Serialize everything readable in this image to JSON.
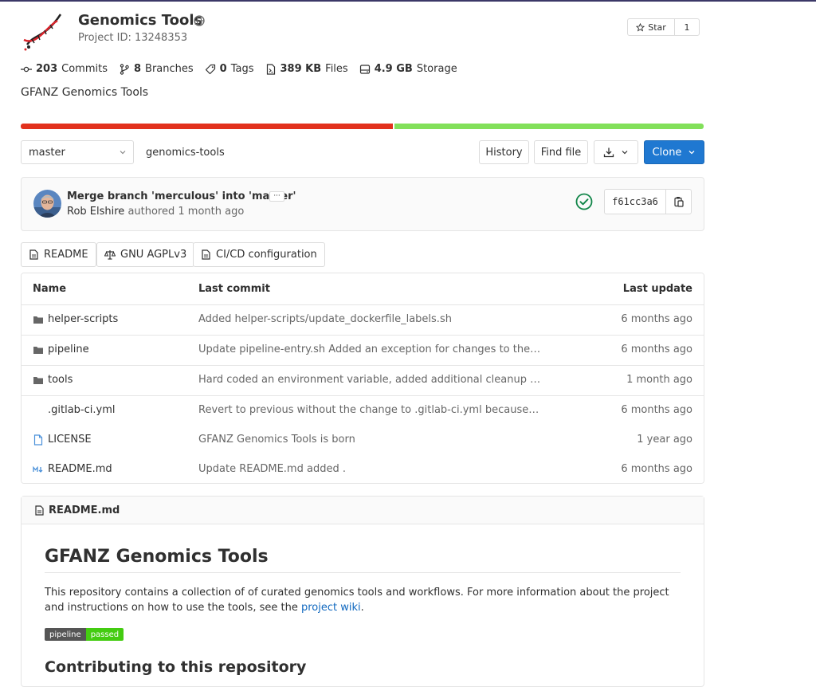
{
  "project": {
    "title": "Genomics Tools",
    "id_text": "Project ID: 13248353",
    "description": "GFANZ Genomics Tools"
  },
  "star": {
    "label": "Star",
    "count": "1"
  },
  "stats": [
    {
      "icon": "commit-icon",
      "value": "203",
      "label": "Commits"
    },
    {
      "icon": "branch-icon",
      "value": "8",
      "label": "Branches"
    },
    {
      "icon": "tag-icon",
      "value": "0",
      "label": "Tags"
    },
    {
      "icon": "file-icon",
      "value": "389 KB",
      "label": "Files"
    },
    {
      "icon": "storage-icon",
      "value": "4.9 GB",
      "label": "Storage"
    }
  ],
  "languages": [
    {
      "color": "#e2311d",
      "share": 0.545
    },
    {
      "color": "#82e05a",
      "share": 0.455
    }
  ],
  "toolbar": {
    "branch": "master",
    "path": "genomics-tools",
    "history": "History",
    "find_file": "Find file",
    "clone": "Clone"
  },
  "commit": {
    "title": "Merge branch 'merculous' into 'master'",
    "more": "···",
    "author": "Rob Elshire",
    "action": "authored",
    "time": "1 month ago",
    "sha": "f61cc3a6",
    "status_color": "#108548"
  },
  "pills": {
    "readme": "README",
    "license": "GNU AGPLv3",
    "ci": "CI/CD configuration"
  },
  "table": {
    "headers": {
      "name": "Name",
      "last_commit": "Last commit",
      "last_update": "Last update"
    },
    "rows": [
      {
        "icon": "folder-icon",
        "name": "helper-scripts",
        "message": "Added helper-scripts/update_dockerfile_labels.sh",
        "date": "6 months ago"
      },
      {
        "icon": "folder-icon",
        "name": "pipeline",
        "message": "Update pipeline-entry.sh Added an exception for changes to the README",
        "date": "6 months ago"
      },
      {
        "icon": "folder-icon",
        "name": "tools",
        "message": "Hard coded an environment variable, added additional cleanup steps",
        "date": "1 month ago"
      },
      {
        "icon": "",
        "name": ".gitlab-ci.yml",
        "message": "Revert to previous without the change to .gitlab-ci.yml because that was",
        "date": "6 months ago"
      },
      {
        "icon": "license-file-icon",
        "name": "LICENSE",
        "message": "GFANZ Genomics Tools is born",
        "date": "1 year ago"
      },
      {
        "icon": "markdown-icon",
        "name": "README.md",
        "message": "Update README.md added .",
        "date": "6 months ago"
      }
    ]
  },
  "readme": {
    "filename": "README.md",
    "h1": "GFANZ Genomics Tools",
    "paragraph_before_link": "This repository contains a collection of of curated genomics tools and workflows. For more information about the project and instructions on how to use the tools, see the ",
    "link_text": "project wiki",
    "paragraph_after_link": ".",
    "badge_left": "pipeline",
    "badge_right": "passed",
    "h2": "Contributing to this repository"
  }
}
